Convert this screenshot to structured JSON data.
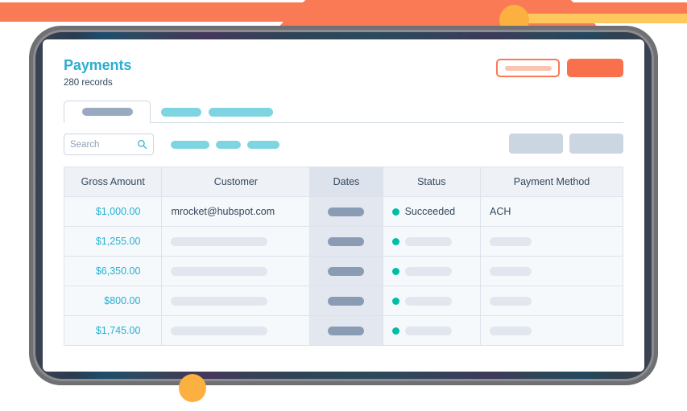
{
  "decor": {
    "orange": "#fa7a56",
    "yellow_bar": "#fdc95f",
    "dot": "#fbb040",
    "dot_top_right_name": "yellow-dot",
    "dot_bottom_left_name": "yellow-dot"
  },
  "header": {
    "title": "Payments",
    "record_count": "280 records",
    "accent_color": "#2daed0"
  },
  "head_actions": {
    "outline_button_label": "",
    "solid_button_label": ""
  },
  "tabs": [
    {
      "label": "",
      "active": true
    },
    {
      "label": "",
      "active": false
    },
    {
      "label": "",
      "active": false
    }
  ],
  "search": {
    "placeholder": "Search",
    "value": "",
    "icon": "search-icon"
  },
  "filters": [
    {
      "label": ""
    },
    {
      "label": ""
    },
    {
      "label": ""
    }
  ],
  "right_actions": [
    {
      "label": ""
    },
    {
      "label": ""
    }
  ],
  "table": {
    "columns": [
      {
        "key": "gross",
        "label": "Gross Amount",
        "highlight": false
      },
      {
        "key": "cust",
        "label": "Customer",
        "highlight": false
      },
      {
        "key": "dates",
        "label": "Dates",
        "highlight": true
      },
      {
        "key": "status",
        "label": "Status",
        "highlight": false
      },
      {
        "key": "method",
        "label": "Payment Method",
        "highlight": false
      }
    ],
    "rows": [
      {
        "gross": "$1,000.00",
        "customer": "mrocket@hubspot.com",
        "customer_placeholder": false,
        "dates": "",
        "status": "Succeeded",
        "status_placeholder": false,
        "method": "ACH",
        "method_placeholder": false
      },
      {
        "gross": "$1,255.00",
        "customer": "",
        "customer_placeholder": true,
        "dates": "",
        "status": "",
        "status_placeholder": true,
        "method": "",
        "method_placeholder": true
      },
      {
        "gross": "$6,350.00",
        "customer": "",
        "customer_placeholder": true,
        "dates": "",
        "status": "",
        "status_placeholder": true,
        "method": "",
        "method_placeholder": true
      },
      {
        "gross": "$800.00",
        "customer": "",
        "customer_placeholder": true,
        "dates": "",
        "status": "",
        "status_placeholder": true,
        "method": "",
        "method_placeholder": true
      },
      {
        "gross": "$1,745.00",
        "customer": "",
        "customer_placeholder": true,
        "dates": "",
        "status": "",
        "status_placeholder": true,
        "method": "",
        "method_placeholder": true
      }
    ],
    "amount_color": "#25b0cf",
    "status_dot_color": "#00bda5"
  }
}
